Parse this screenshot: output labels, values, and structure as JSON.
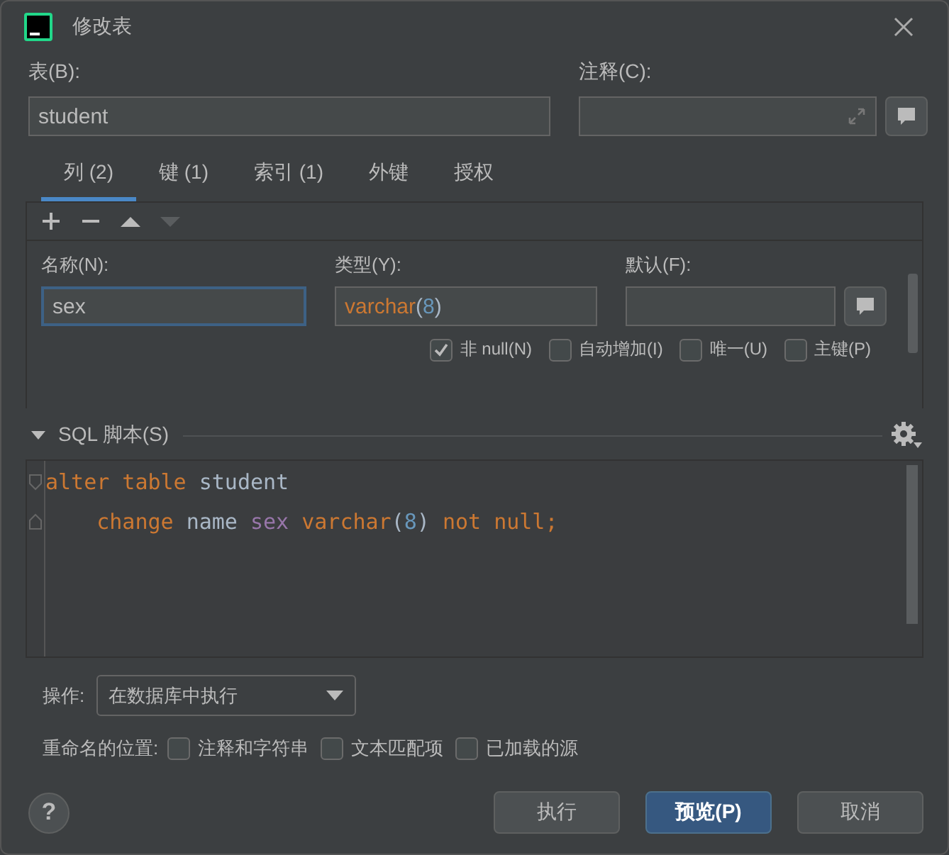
{
  "window": {
    "title": "修改表"
  },
  "table_field": {
    "label": "表(B):",
    "value": "student"
  },
  "comment_field": {
    "label": "注释(C):"
  },
  "tabs": [
    {
      "label": "列 (2)",
      "selected": true
    },
    {
      "label": "键 (1)",
      "selected": false
    },
    {
      "label": "索引 (1)",
      "selected": false
    },
    {
      "label": "外键",
      "selected": false
    },
    {
      "label": "授权",
      "selected": false
    }
  ],
  "toolbar": [
    {
      "kind": "add",
      "disabled": false
    },
    {
      "kind": "remove",
      "disabled": false
    },
    {
      "kind": "up",
      "disabled": false
    },
    {
      "kind": "down",
      "disabled": true
    }
  ],
  "column": {
    "name": {
      "label": "名称(N):",
      "value": "sex"
    },
    "type": {
      "label": "类型(Y):",
      "type_name": "varchar",
      "open": "(",
      "size": "8",
      "close": ")"
    },
    "default": {
      "label": "默认(F):"
    },
    "flags": [
      {
        "label": "非 null(N)",
        "checked": true
      },
      {
        "label": "自动增加(I)",
        "checked": false
      },
      {
        "label": "唯一(U)",
        "checked": false
      },
      {
        "label": "主键(P)",
        "checked": false
      }
    ]
  },
  "sql": {
    "title": "SQL 脚本(S)",
    "expanded": true,
    "lines": [
      [
        {
          "text": "alter",
          "kind": "keyword"
        },
        {
          "text": " table",
          "kind": "keyword"
        },
        {
          "text": " student",
          "kind": "plain"
        }
      ],
      [
        {
          "text": "    change",
          "kind": "keyword"
        },
        {
          "text": " name",
          "kind": "plain"
        },
        {
          "text": " sex",
          "kind": "column"
        },
        {
          "text": " varchar",
          "kind": "keyword"
        },
        {
          "text": "(",
          "kind": "plain"
        },
        {
          "text": "8",
          "kind": "number"
        },
        {
          "text": ")",
          "kind": "plain"
        },
        {
          "text": " not",
          "kind": "keyword"
        },
        {
          "text": " null;",
          "kind": "keyword"
        }
      ]
    ]
  },
  "operation": {
    "label": "操作:",
    "value": "在数据库中执行"
  },
  "rename": {
    "label": "重命名的位置:",
    "options": [
      {
        "label": "注释和字符串",
        "checked": false
      },
      {
        "label": "文本匹配项",
        "checked": false
      },
      {
        "label": "已加载的源",
        "checked": false
      }
    ]
  },
  "help": {
    "label": "?"
  },
  "buttons": [
    {
      "label": "执行",
      "kind": "normal"
    },
    {
      "label": "预览(P)",
      "kind": "default"
    },
    {
      "label": "取消",
      "kind": "normal"
    }
  ]
}
